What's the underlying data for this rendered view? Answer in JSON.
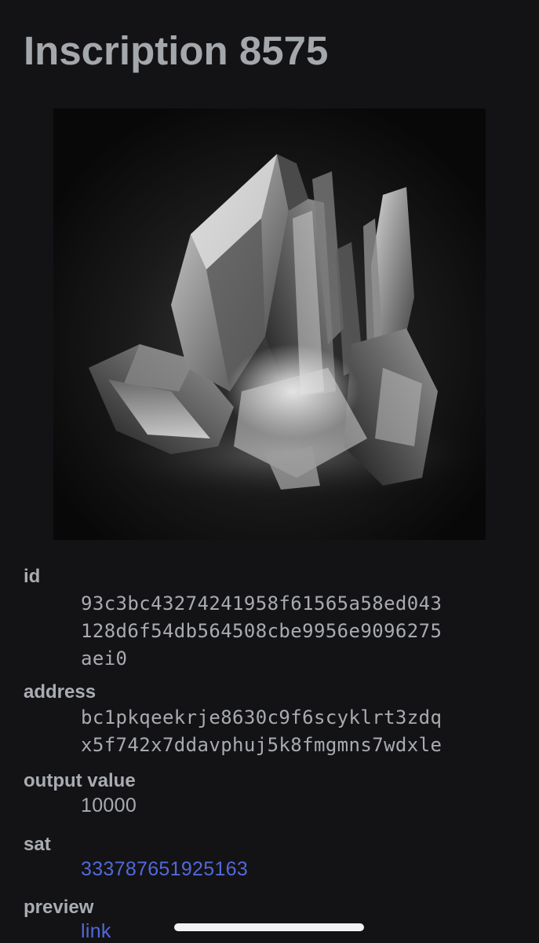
{
  "page": {
    "title": "Inscription 8575"
  },
  "artwork": {
    "subject": "crystal-cluster-image"
  },
  "details": {
    "id": {
      "label": "id",
      "lines": [
        "93c3bc43274241958f61565a58ed043",
        "128d6f54db564508cbe9956e9096275",
        "aei0"
      ]
    },
    "address": {
      "label": "address",
      "lines": [
        "bc1pkqeekrje8630c9f6scyklrt3zdq",
        "x5f742x7ddavphuj5k8fmgmns7wdxle"
      ]
    },
    "output_value": {
      "label": "output value",
      "value": "10000"
    },
    "sat": {
      "label": "sat",
      "value": "333787651925163"
    },
    "preview": {
      "label": "preview",
      "value": "link"
    }
  },
  "colors": {
    "background": "#131316",
    "text": "#a8abb0",
    "link": "#5368d8",
    "home_indicator": "#f2f2f4"
  }
}
